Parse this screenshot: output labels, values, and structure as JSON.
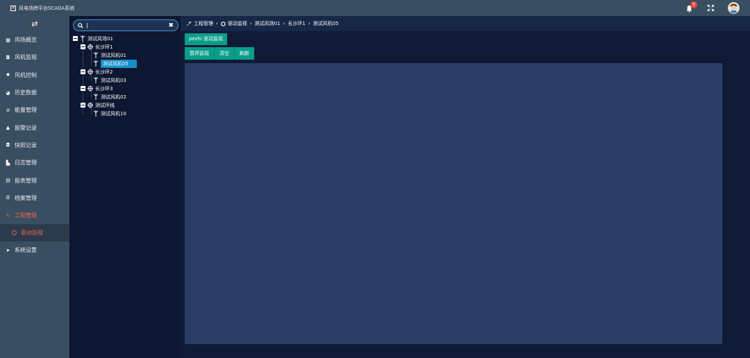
{
  "app": {
    "title": "风电场跨平台SCADA系统",
    "logo_glyph": "✕"
  },
  "header": {
    "notifications_count": "0"
  },
  "sidebar": {
    "toggle_glyph": "⇄",
    "items": [
      {
        "label": "风场概览",
        "icon": "grid-icon"
      },
      {
        "label": "风机监视",
        "icon": "camera-icon"
      },
      {
        "label": "风机控制",
        "icon": "gear-icon"
      },
      {
        "label": "历史数据",
        "icon": "pie-chart-icon"
      },
      {
        "label": "能量管理",
        "icon": "leaf-icon"
      },
      {
        "label": "报警记录",
        "icon": "bell-icon"
      },
      {
        "label": "快照记录",
        "icon": "camera-icon"
      },
      {
        "label": "日志管理",
        "icon": "file-icon"
      },
      {
        "label": "报表管理",
        "icon": "table-icon"
      },
      {
        "label": "档案管理",
        "icon": "list-icon"
      },
      {
        "label": "工程管理",
        "icon": "wrench-icon"
      },
      {
        "label": "系统设置",
        "icon": "send-icon"
      }
    ],
    "subitem": {
      "label": "驱动监视"
    }
  },
  "tree": {
    "search": {
      "value": "|",
      "placeholder": ""
    },
    "nodes": {
      "root": "测试风场01",
      "ring1": "长沙环1",
      "t01": "测试风机01",
      "t05": "测试风机05",
      "ring2": "长沙环2",
      "t03": "测试风机03",
      "ring3": "长沙环3",
      "t02": "测试风机02",
      "ring4": "测试环线",
      "t10": "测试风机10"
    }
  },
  "breadcrumb": {
    "items": [
      "工程管理",
      "驱动监视",
      "测试风场01",
      "长沙环1",
      "测试风机05"
    ],
    "sep": "›"
  },
  "main": {
    "tab_label": "pezhi 驱动监视",
    "toolbar": {
      "pause": "暂停监视",
      "clear": "清空",
      "refresh": "刷新"
    }
  },
  "colors": {
    "accent_teal": "#0a9e8a",
    "active_red": "#f3624d",
    "selected_blue": "#1690c8"
  }
}
